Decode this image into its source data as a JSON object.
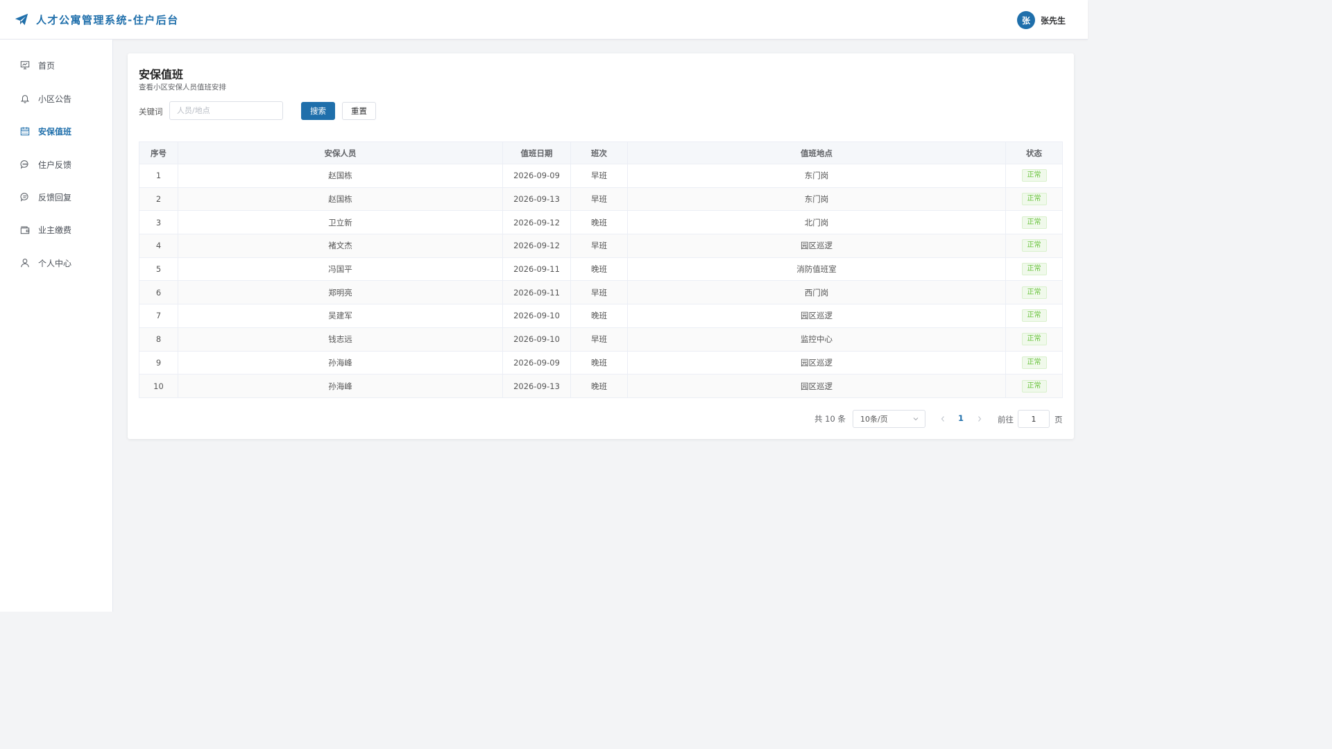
{
  "header": {
    "app_title": "人才公寓管理系统-住户后台",
    "user": {
      "avatar_text": "张",
      "name": "张先生"
    }
  },
  "sidebar": {
    "items": [
      {
        "label": "首页",
        "icon": "presentation-chart-icon"
      },
      {
        "label": "小区公告",
        "icon": "bell-icon"
      },
      {
        "label": "安保值班",
        "icon": "calendar-icon",
        "active": true
      },
      {
        "label": "住户反馈",
        "icon": "chat-bubble-icon"
      },
      {
        "label": "反馈回复",
        "icon": "chat-reply-icon"
      },
      {
        "label": "业主缴费",
        "icon": "wallet-icon"
      },
      {
        "label": "个人中心",
        "icon": "user-icon"
      }
    ]
  },
  "main": {
    "title": "安保值班",
    "subtitle": "查看小区安保人员值班安排",
    "search": {
      "label": "关键词",
      "placeholder": "人员/地点",
      "value": "",
      "search_button": "搜索",
      "reset_button": "重置"
    },
    "table": {
      "columns": [
        "序号",
        "安保人员",
        "值班日期",
        "班次",
        "值班地点",
        "状态"
      ],
      "rows": [
        {
          "index": "1",
          "person": "赵国栋",
          "date": "2026-09-09",
          "shift": "早班",
          "location": "东门岗",
          "status": "正常"
        },
        {
          "index": "2",
          "person": "赵国栋",
          "date": "2026-09-13",
          "shift": "早班",
          "location": "东门岗",
          "status": "正常"
        },
        {
          "index": "3",
          "person": "卫立新",
          "date": "2026-09-12",
          "shift": "晚班",
          "location": "北门岗",
          "status": "正常"
        },
        {
          "index": "4",
          "person": "褚文杰",
          "date": "2026-09-12",
          "shift": "早班",
          "location": "园区巡逻",
          "status": "正常"
        },
        {
          "index": "5",
          "person": "冯国平",
          "date": "2026-09-11",
          "shift": "晚班",
          "location": "消防值班室",
          "status": "正常"
        },
        {
          "index": "6",
          "person": "郑明亮",
          "date": "2026-09-11",
          "shift": "早班",
          "location": "西门岗",
          "status": "正常"
        },
        {
          "index": "7",
          "person": "吴建军",
          "date": "2026-09-10",
          "shift": "晚班",
          "location": "园区巡逻",
          "status": "正常"
        },
        {
          "index": "8",
          "person": "钱志远",
          "date": "2026-09-10",
          "shift": "早班",
          "location": "监控中心",
          "status": "正常"
        },
        {
          "index": "9",
          "person": "孙海峰",
          "date": "2026-09-09",
          "shift": "晚班",
          "location": "园区巡逻",
          "status": "正常"
        },
        {
          "index": "10",
          "person": "孙海峰",
          "date": "2026-09-13",
          "shift": "晚班",
          "location": "园区巡逻",
          "status": "正常"
        }
      ]
    },
    "pagination": {
      "total_text": "共 10 条",
      "page_size": "10条/页",
      "current_page": "1",
      "goto_label": "前往",
      "goto_value": "1",
      "page_suffix": "页"
    }
  },
  "colors": {
    "brand": "#1f6fab",
    "status_success": "#67c23a",
    "background": "#f3f4f6"
  }
}
